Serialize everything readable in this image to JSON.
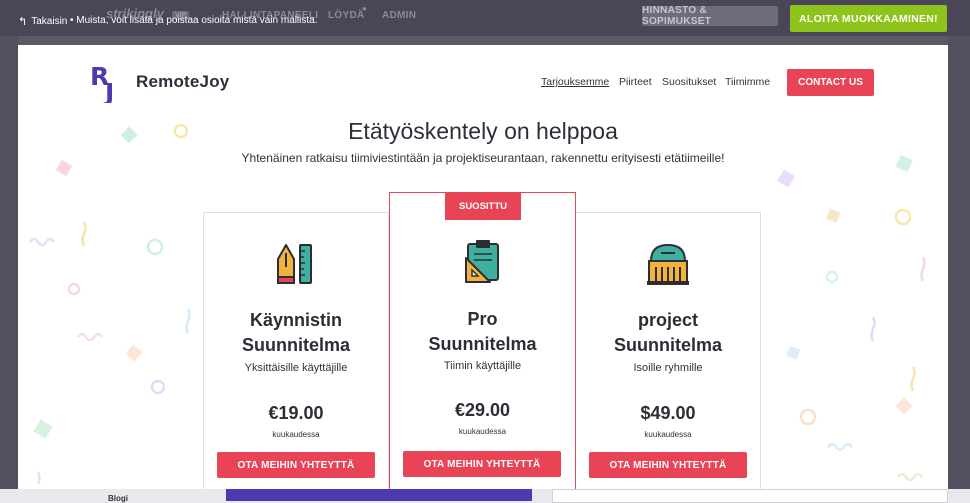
{
  "editor": {
    "back_label": "Takaisin",
    "hint": "Muista, voit lisätä ja poistaa osioita mistä vain mallista.",
    "brand": "strikingly",
    "brand_tag": "VIP",
    "nav": [
      "HALLINTAPANEELI",
      "LÖYDÄ",
      "ADMIN"
    ],
    "pricing_button": "HINNASTO & SOPIMUKSET",
    "start_button": "ALOITA MUOKKAAMINEN!",
    "bottom_label": "Blogi"
  },
  "site": {
    "logo_letters": "RJ",
    "name": "RemoteJoy",
    "nav": [
      "Tarjouksemme",
      "Piirteet",
      "Suositukset",
      "Tiimimme"
    ],
    "contact_button": "CONTACT US",
    "hero_title": "Etätyöskentely on helppoa",
    "hero_subtitle": "Yhtenäinen ratkaisu tiimiviestintään ja projektiseurantaan, rakennettu erityisesti etätiimeille!"
  },
  "plans": [
    {
      "icon": "pen-ruler-icon",
      "title_line1": "Käynnistin",
      "title_line2": "Suunnitelma",
      "desc": "Yksittäisille käyttäjille",
      "price": "€19.00",
      "period": "kuukaudessa",
      "button": "OTA MEIHIN YHTEYTTÄ"
    },
    {
      "icon": "clipboard-ruler-icon",
      "badge": "SUOSITTU",
      "title_line1": "Pro",
      "title_line2": "Suunnitelma",
      "desc": "Tiimin käyttäjille",
      "price": "€29.00",
      "period": "kuukaudessa",
      "button": "OTA MEIHIN YHTEYTTÄ"
    },
    {
      "icon": "building-icon",
      "title_line1": "project",
      "title_line2": "Suunnitelma",
      "desc": "Isoille ryhmille",
      "price": "$49.00",
      "period": "kuukaudessa",
      "button": "OTA MEIHIN YHTEYTTÄ"
    }
  ],
  "colors": {
    "accent": "#e94356",
    "start_green": "#8ec31c",
    "logo_purple": "#4b3ab0",
    "editor_bar": "#4a4557"
  }
}
